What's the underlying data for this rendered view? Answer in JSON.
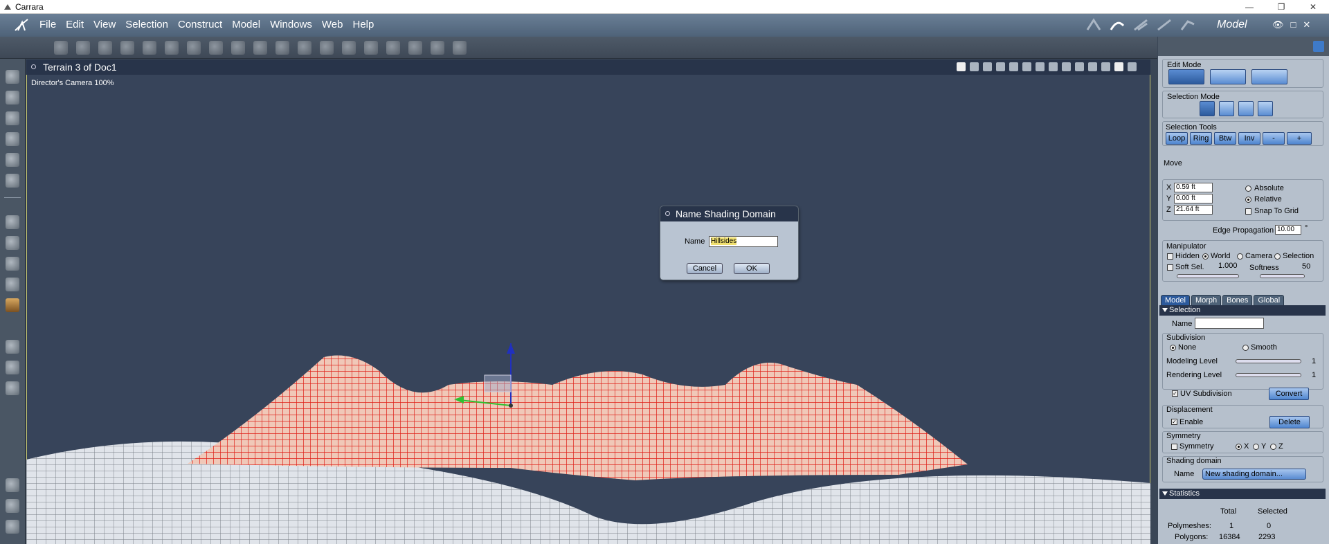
{
  "app": {
    "title": "Carrara"
  },
  "window_controls": {
    "minimize": "—",
    "restore": "❐",
    "close": "✕"
  },
  "menu": [
    "File",
    "Edit",
    "View",
    "Selection",
    "Construct",
    "Model",
    "Windows",
    "Web",
    "Help"
  ],
  "room": {
    "name": "Model"
  },
  "room_controls": {
    "eye": "👁",
    "max": "□",
    "close": "✕"
  },
  "viewport": {
    "title": "Terrain 3 of Doc1",
    "camera_label": "Director's Camera 100%"
  },
  "dialog": {
    "title": "Name Shading Domain",
    "name_label": "Name",
    "name_value": "Hillsides",
    "cancel_label": "Cancel",
    "ok_label": "OK"
  },
  "panel": {
    "edit_mode": {
      "title": "Edit Mode"
    },
    "selection_mode": {
      "title": "Selection Mode"
    },
    "selection_tools": {
      "title": "Selection Tools",
      "buttons": [
        "Loop",
        "Ring",
        "Btw",
        "Inv",
        "-",
        "+"
      ]
    },
    "move": {
      "title": "Move",
      "x_label": "X",
      "x_value": "0.59 ft",
      "y_label": "Y",
      "y_value": "0.00 ft",
      "z_label": "Z",
      "z_value": "21.64 ft",
      "absolute": "Absolute",
      "relative": "Relative",
      "snap": "Snap To Grid",
      "edge_label": "Edge Propagation",
      "edge_value": "10.00",
      "edge_unit": "°"
    },
    "manipulator": {
      "title": "Manipulator",
      "hidden": "Hidden",
      "world": "World",
      "camera": "Camera",
      "selection": "Selection",
      "soft_sel": "Soft Sel.",
      "soft_value": "1.000",
      "softness_label": "Softness",
      "softness_value": "50"
    },
    "tabs": [
      "Model",
      "Morph",
      "Bones",
      "Global"
    ],
    "selection_section": {
      "title": "Selection",
      "name_label": "Name"
    },
    "subdivision": {
      "title": "Subdivision",
      "none": "None",
      "smooth": "Smooth",
      "modeling_level": "Modeling Level",
      "modeling_value": "1",
      "rendering_level": "Rendering Level",
      "rendering_value": "1",
      "uv": "UV Subdivision",
      "convert": "Convert"
    },
    "displacement": {
      "title": "Displacement",
      "enable": "Enable",
      "delete": "Delete"
    },
    "symmetry": {
      "title": "Symmetry",
      "label": "Symmetry",
      "x": "X",
      "y": "Y",
      "z": "Z"
    },
    "shading_domain": {
      "title": "Shading domain",
      "name_label": "Name",
      "value": "New shading domain..."
    },
    "statistics": {
      "title": "Statistics",
      "total_header": "Total",
      "selected_header": "Selected",
      "rows": [
        {
          "label": "Polymeshes:",
          "total": "1",
          "selected": "0"
        },
        {
          "label": "Polygons:",
          "total": "16384",
          "selected": "2293"
        }
      ]
    }
  },
  "colors": {
    "selected_mesh": "#e8281c",
    "mesh": "#dfe3ea",
    "viewport_bg": "#37445a",
    "panel_bg": "#b6c0cc"
  }
}
